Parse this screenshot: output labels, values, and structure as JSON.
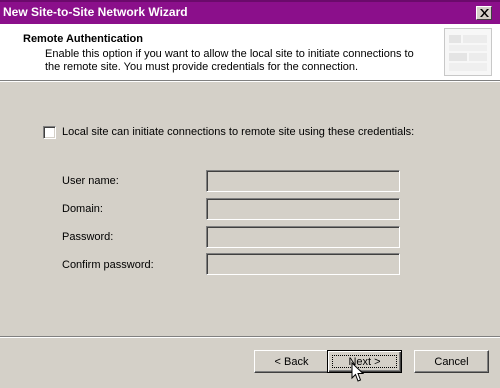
{
  "window": {
    "title": "New Site-to-Site Network Wizard"
  },
  "header": {
    "title": "Remote Authentication",
    "description": "Enable this option if you want to allow the local site to initiate connections to the remote site. You must provide credentials for the connection."
  },
  "options": {
    "checkbox_label": "Local site can initiate connections to remote site using these credentials:",
    "checkbox_checked": false
  },
  "fields": [
    {
      "label": "User name:",
      "value": ""
    },
    {
      "label": "Domain:",
      "value": ""
    },
    {
      "label": "Password:",
      "value": ""
    },
    {
      "label": "Confirm password:",
      "value": ""
    }
  ],
  "buttons": {
    "back": "< Back",
    "next": "Next >",
    "cancel": "Cancel"
  },
  "colors": {
    "titlebar": "#8b0f8b",
    "face": "#d4d0c8",
    "header_bg": "#ffffff"
  },
  "icons": {
    "close": "close-icon",
    "wizard_graphic": "wizard-header-icon",
    "pointer": "mouse-pointer-icon"
  }
}
